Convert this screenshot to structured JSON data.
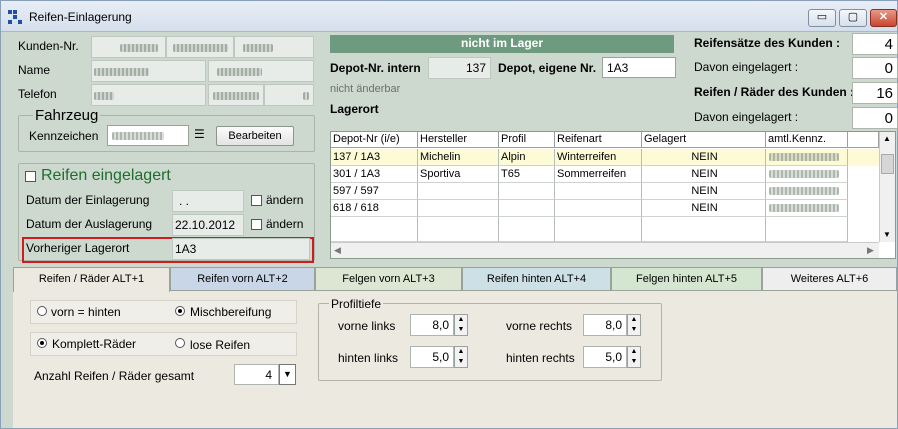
{
  "window": {
    "title": "Reifen-Einlagerung",
    "minimize": "▭",
    "maximize": "▢",
    "close": "✕"
  },
  "customer": {
    "kunden_nr_label": "Kunden-Nr.",
    "name_label": "Name",
    "telefon_label": "Telefon"
  },
  "vehicle": {
    "group_label": "Fahrzeug",
    "kennzeichen_label": "Kennzeichen",
    "edit_button": "Bearbeiten"
  },
  "storage": {
    "checkbox_label": "Reifen eingelagert",
    "datum_einlagerung_label": "Datum der Einlagerung",
    "datum_einlagerung_value": ". .",
    "datum_auslagerung_label": "Datum der Auslagerung",
    "datum_auslagerung_value": "22.10.2012",
    "aendern1": "ändern",
    "aendern2": "ändern",
    "vorheriger_lagerort_label": "Vorheriger Lagerort",
    "vorheriger_lagerort_value": "1A3"
  },
  "depot": {
    "status_banner": "nicht im Lager",
    "depot_intern_label": "Depot-Nr. intern",
    "depot_intern_value": "137",
    "depot_eigene_label": "Depot, eigene Nr.",
    "depot_eigene_value": "1A3",
    "nicht_aenderbar": "nicht änderbar",
    "lagerort_label": "Lagerort"
  },
  "summary": {
    "reifensaetze_label": "Reifensätze des Kunden :",
    "reifensaetze_value": "4",
    "davon1_label": "Davon eingelagert :",
    "davon1_value": "0",
    "reifen_raeder_label": "Reifen / Räder des Kunden :",
    "reifen_raeder_value": "16",
    "davon2_label": "Davon eingelagert :",
    "davon2_value": "0"
  },
  "table": {
    "headers": [
      "Depot-Nr (i/e)",
      "Hersteller",
      "Profil",
      "Reifenart",
      "Gelagert",
      "amtl.Kennz."
    ],
    "rows": [
      [
        "137 / 1A3",
        "Michelin",
        "Alpin",
        "Winterreifen",
        "NEIN",
        ""
      ],
      [
        "301 / 1A3",
        "Sportiva",
        "T65",
        "Sommerreifen",
        "NEIN",
        ""
      ],
      [
        "597 / 597",
        "",
        "",
        "",
        "NEIN",
        ""
      ],
      [
        "618 / 618",
        "",
        "",
        "",
        "NEIN",
        ""
      ]
    ]
  },
  "tabs": [
    {
      "label": "Reifen / Räder ALT+1",
      "color": "#ece9e1"
    },
    {
      "label": "Reifen vorn ALT+2",
      "color": "#c9d6e8"
    },
    {
      "label": "Felgen vorn ALT+3",
      "color": "#dde6d2"
    },
    {
      "label": "Reifen hinten ALT+4",
      "color": "#cde0e6"
    },
    {
      "label": "Felgen hinten ALT+5",
      "color": "#d4e6cf"
    },
    {
      "label": "Weiteres ALT+6",
      "color": "#eeeeee"
    }
  ],
  "tabpanel": {
    "vorn_hinten": "vorn = hinten",
    "mischbereifung": "Mischbereifung",
    "komplett": "Komplett-Räder",
    "lose": "lose Reifen",
    "anzahl_label": "Anzahl Reifen / Räder gesamt",
    "anzahl_value": "4",
    "profil_group": "Profiltiefe",
    "vorne_links_label": "vorne links",
    "vorne_links_value": "8,0",
    "vorne_rechts_label": "vorne rechts",
    "vorne_rechts_value": "8,0",
    "hinten_links_label": "hinten links",
    "hinten_links_value": "5,0",
    "hinten_rechts_label": "hinten rechts",
    "hinten_rechts_value": "5,0"
  }
}
